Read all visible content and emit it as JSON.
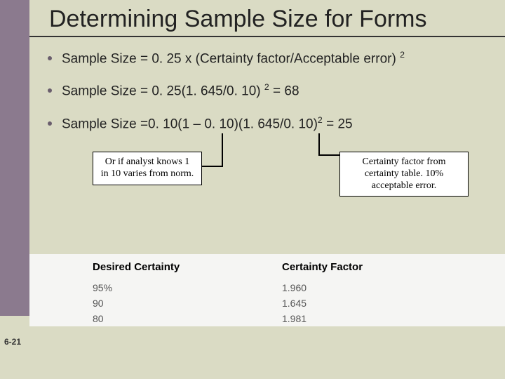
{
  "title": "Determining Sample Size for Forms",
  "bullets": [
    {
      "prefix": "Sample Size = 0. 25 x (Certainty factor/Acceptable error) ",
      "sup": "2"
    },
    {
      "prefix": "Sample Size = 0. 25(1. 645/0. 10) ",
      "sup": "2",
      "suffix": " = 68"
    },
    {
      "prefix": "Sample Size =0. 10(1 – 0. 10)(1. 645/0. 10)",
      "sup": "2",
      "suffix": " = 25"
    }
  ],
  "callouts": {
    "left": "Or if analyst knows 1 in 10 varies from norm.",
    "right": "Certainty factor from certainty table. 10% acceptable error."
  },
  "table": {
    "headers": {
      "col1": "Desired Certainty",
      "col2": "Certainty Factor"
    },
    "rows": [
      {
        "c1": "95%",
        "c2": "1.960"
      },
      {
        "c1": "90",
        "c2": "1.645"
      },
      {
        "c1": "80",
        "c2": "1.981"
      }
    ]
  },
  "page": "6-21",
  "chart_data": {
    "type": "table",
    "title": "Certainty Factor Table",
    "columns": [
      "Desired Certainty",
      "Certainty Factor"
    ],
    "rows": [
      [
        "95%",
        1.96
      ],
      [
        "90",
        1.645
      ],
      [
        "80",
        1.981
      ]
    ]
  }
}
